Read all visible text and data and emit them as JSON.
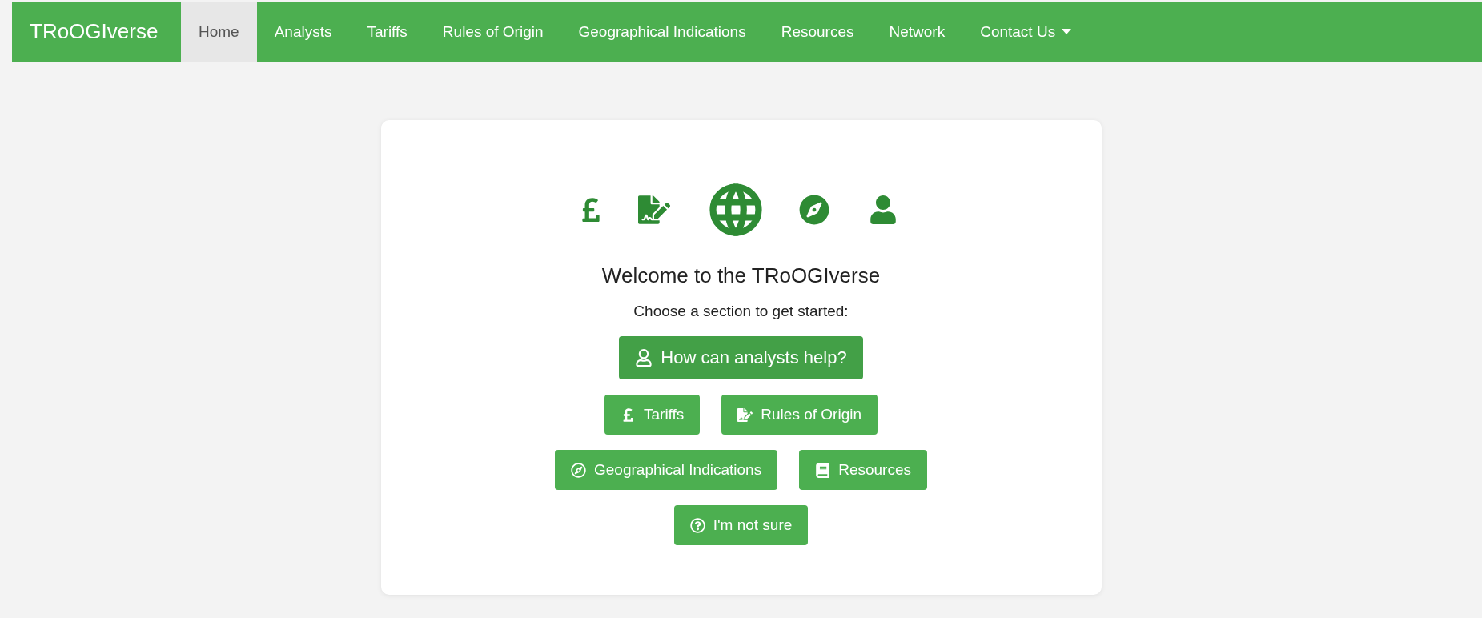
{
  "navbar": {
    "brand": "TRoOGIverse",
    "items": [
      {
        "label": "Home",
        "selected": true,
        "dropdown": false
      },
      {
        "label": "Analysts",
        "selected": false,
        "dropdown": false
      },
      {
        "label": "Tariffs",
        "selected": false,
        "dropdown": false
      },
      {
        "label": "Rules of Origin",
        "selected": false,
        "dropdown": false
      },
      {
        "label": "Geographical Indications",
        "selected": false,
        "dropdown": false
      },
      {
        "label": "Resources",
        "selected": false,
        "dropdown": false
      },
      {
        "label": "Network",
        "selected": false,
        "dropdown": false
      },
      {
        "label": "Contact Us",
        "selected": false,
        "dropdown": true
      }
    ]
  },
  "welcome": {
    "title": "Welcome to the TRoOGIverse",
    "subtitle": "Choose a section to get started:",
    "button_rows": [
      [
        {
          "label": "How can analysts help?",
          "kind": "large"
        }
      ],
      [
        {
          "label": "Tariffs",
          "kind": "normal"
        },
        {
          "label": "Rules of Origin",
          "kind": "normal"
        }
      ],
      [
        {
          "label": "Geographical Indications",
          "kind": "normal"
        },
        {
          "label": "Resources",
          "kind": "normal"
        }
      ],
      [
        {
          "label": "I'm not sure",
          "kind": "normal"
        }
      ]
    ]
  }
}
